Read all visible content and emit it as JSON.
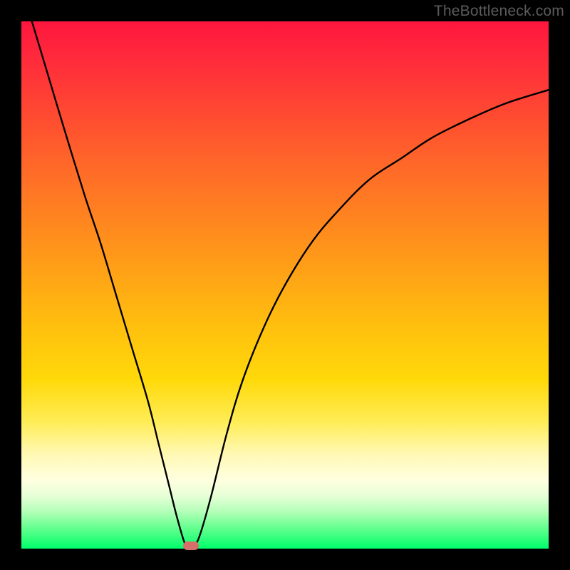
{
  "watermark": "TheBottleneck.com",
  "chart_data": {
    "type": "line",
    "title": "",
    "xlabel": "",
    "ylabel": "",
    "xlim": [
      0,
      100
    ],
    "ylim": [
      0,
      100
    ],
    "grid": false,
    "legend": false,
    "series": [
      {
        "name": "bottleneck-curve",
        "x": [
          2,
          5,
          8,
          12,
          15,
          18,
          21,
          24,
          26,
          28,
          29.5,
          31,
          32,
          33,
          34,
          36,
          39,
          42,
          46,
          50,
          55,
          60,
          66,
          72,
          78,
          85,
          92,
          100
        ],
        "y": [
          100,
          90,
          80,
          67,
          58,
          48,
          38,
          28,
          20,
          12,
          6,
          1,
          0.2,
          0.8,
          3,
          10,
          22,
          32,
          42,
          50,
          58,
          64,
          70,
          74,
          78,
          81.5,
          84.5,
          87
        ],
        "color": "#000000"
      }
    ],
    "annotations": [
      {
        "name": "optimum-marker",
        "x": 32.2,
        "y": 0.6,
        "color": "#d66f6a"
      }
    ],
    "background_gradient": {
      "orientation": "vertical",
      "stops": [
        {
          "pos": 0.0,
          "color": "#ff163e"
        },
        {
          "pos": 0.5,
          "color": "#ffb012"
        },
        {
          "pos": 0.8,
          "color": "#fff49a"
        },
        {
          "pos": 1.0,
          "color": "#00ff6a"
        }
      ]
    }
  }
}
